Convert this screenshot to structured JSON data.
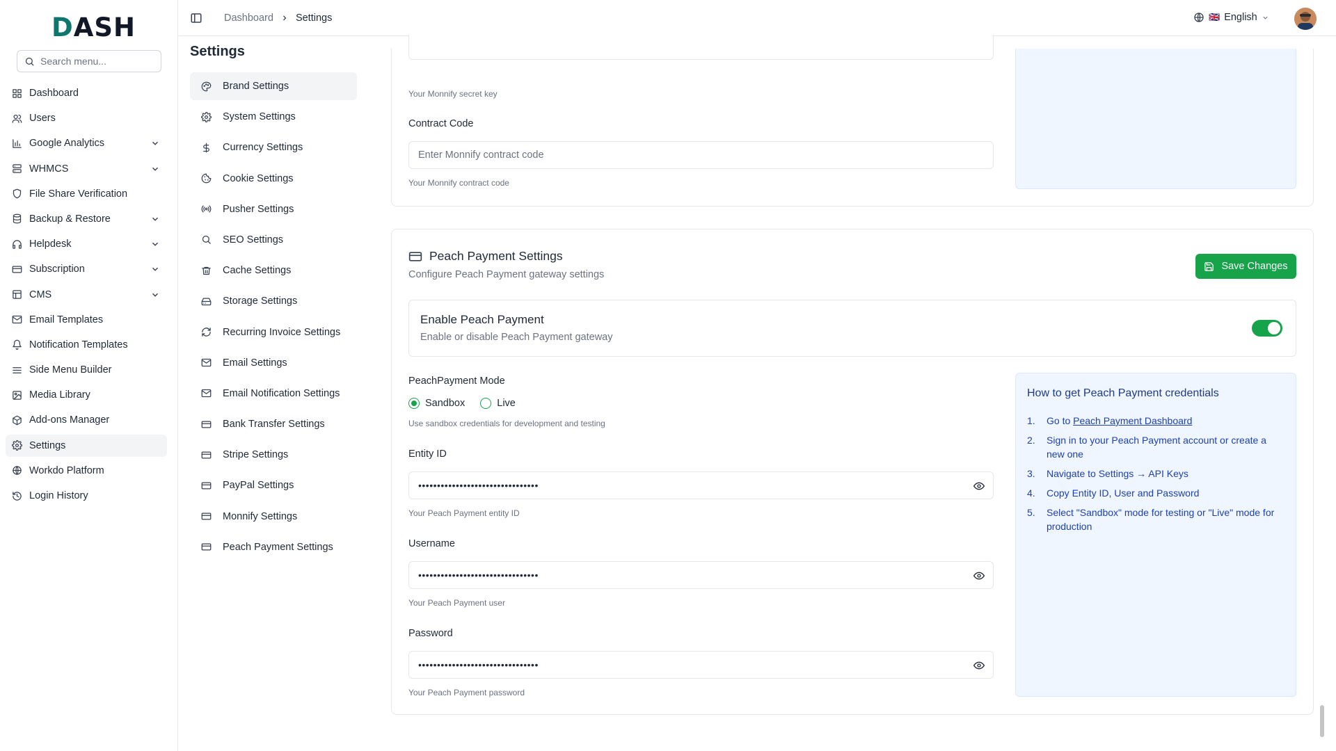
{
  "app": {
    "logo_text": "DASH"
  },
  "search": {
    "placeholder": "Search menu..."
  },
  "sidebar": {
    "items": [
      {
        "label": "Dashboard",
        "icon": "grid-icon",
        "has_chevron": false
      },
      {
        "label": "Users",
        "icon": "users-icon",
        "has_chevron": false
      },
      {
        "label": "Google Analytics",
        "icon": "bar-chart-icon",
        "has_chevron": true
      },
      {
        "label": "WHMCS",
        "icon": "server-icon",
        "has_chevron": true
      },
      {
        "label": "File Share Verification",
        "icon": "shield-icon",
        "has_chevron": false
      },
      {
        "label": "Backup & Restore",
        "icon": "database-icon",
        "has_chevron": true
      },
      {
        "label": "Helpdesk",
        "icon": "headphones-icon",
        "has_chevron": true
      },
      {
        "label": "Subscription",
        "icon": "credit-card-icon",
        "has_chevron": true
      },
      {
        "label": "CMS",
        "icon": "layout-icon",
        "has_chevron": true
      },
      {
        "label": "Email Templates",
        "icon": "mail-icon",
        "has_chevron": false
      },
      {
        "label": "Notification Templates",
        "icon": "bell-icon",
        "has_chevron": false
      },
      {
        "label": "Side Menu Builder",
        "icon": "menu-icon",
        "has_chevron": false
      },
      {
        "label": "Media Library",
        "icon": "image-icon",
        "has_chevron": false
      },
      {
        "label": "Add-ons Manager",
        "icon": "package-icon",
        "has_chevron": false
      },
      {
        "label": "Settings",
        "icon": "gear-icon",
        "has_chevron": false,
        "active": true
      },
      {
        "label": "Workdo Platform",
        "icon": "globe-icon",
        "has_chevron": false
      },
      {
        "label": "Login History",
        "icon": "history-icon",
        "has_chevron": false
      }
    ]
  },
  "header": {
    "breadcrumb": [
      "Dashboard",
      "Settings"
    ],
    "language": "English",
    "language_flag": "🇬🇧"
  },
  "page": {
    "title": "Settings"
  },
  "settings_nav": {
    "items": [
      {
        "label": "Brand Settings",
        "icon": "palette-icon",
        "active": true
      },
      {
        "label": "System Settings",
        "icon": "gear-icon"
      },
      {
        "label": "Currency Settings",
        "icon": "dollar-icon"
      },
      {
        "label": "Cookie Settings",
        "icon": "cookie-icon"
      },
      {
        "label": "Pusher Settings",
        "icon": "broadcast-icon"
      },
      {
        "label": "SEO Settings",
        "icon": "search-icon"
      },
      {
        "label": "Cache Settings",
        "icon": "trash-icon"
      },
      {
        "label": "Storage Settings",
        "icon": "hard-drive-icon"
      },
      {
        "label": "Recurring Invoice Settings",
        "icon": "refresh-icon"
      },
      {
        "label": "Email Settings",
        "icon": "mail-icon"
      },
      {
        "label": "Email Notification Settings",
        "icon": "mail-icon"
      },
      {
        "label": "Bank Transfer Settings",
        "icon": "credit-card-icon"
      },
      {
        "label": "Stripe Settings",
        "icon": "credit-card-icon"
      },
      {
        "label": "PayPal Settings",
        "icon": "credit-card-icon"
      },
      {
        "label": "Monnify Settings",
        "icon": "credit-card-icon"
      },
      {
        "label": "Peach Payment Settings",
        "icon": "credit-card-icon"
      }
    ]
  },
  "monnify": {
    "secret_key_hint": "Your Monnify secret key",
    "contract_code_label": "Contract Code",
    "contract_code_placeholder": "Enter Monnify contract code",
    "contract_code_hint": "Your Monnify contract code"
  },
  "peach": {
    "title": "Peach Payment Settings",
    "description": "Configure Peach Payment gateway settings",
    "save_label": "Save Changes",
    "enable_title": "Enable Peach Payment",
    "enable_description": "Enable or disable Peach Payment gateway",
    "enabled": true,
    "mode_label": "PeachPayment Mode",
    "mode_options": [
      "Sandbox",
      "Live"
    ],
    "mode_selected": "Sandbox",
    "mode_hint": "Use sandbox credentials for development and testing",
    "entity_id_label": "Entity ID",
    "entity_id_value": "••••••••••••••••••••••••••••••••",
    "entity_id_hint": "Your Peach Payment entity ID",
    "username_label": "Username",
    "username_value": "••••••••••••••••••••••••••••••••",
    "username_hint": "Your Peach Payment user",
    "password_label": "Password",
    "password_value": "••••••••••••••••••••••••••••••••",
    "password_hint": "Your Peach Payment password",
    "how_title": "How to get Peach Payment credentials",
    "how_steps": [
      {
        "num": "1.",
        "prefix": "Go to ",
        "link": "Peach Payment Dashboard"
      },
      {
        "num": "2.",
        "text": "Sign in to your Peach Payment account or create a new one"
      },
      {
        "num": "3.",
        "text": "Navigate to Settings → API Keys"
      },
      {
        "num": "4.",
        "text": "Copy Entity ID, User and Password"
      },
      {
        "num": "5.",
        "text": "Select \"Sandbox\" mode for testing or \"Live\" mode for production"
      }
    ]
  },
  "colors": {
    "accent": "#16a34a",
    "info_bg": "#eff6ff",
    "info_text": "#1e40af"
  }
}
